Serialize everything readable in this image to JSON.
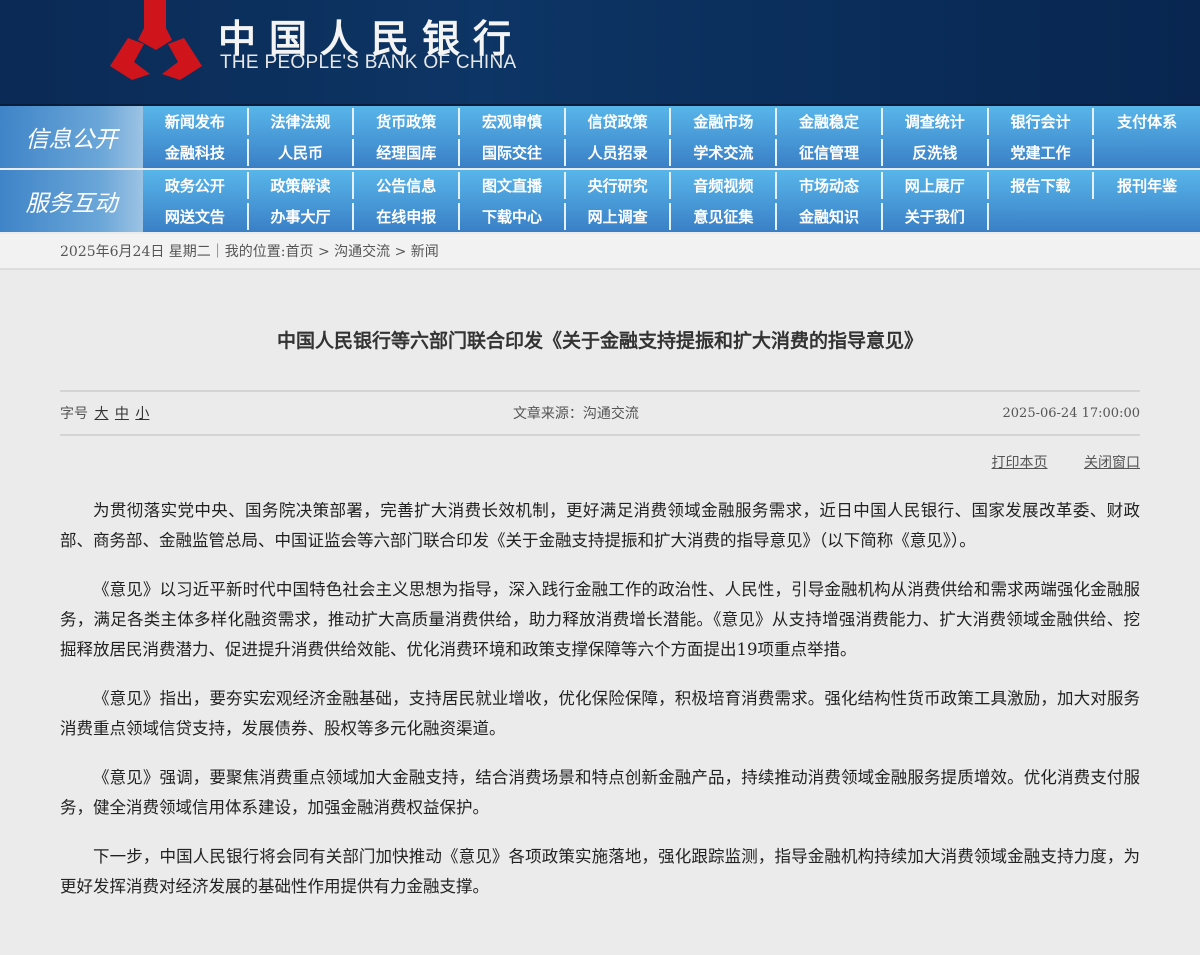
{
  "header": {
    "logo_cn": "中国人民银行",
    "logo_en": "THE PEOPLE'S BANK OF CHINA"
  },
  "nav": [
    {
      "label": "信息公开",
      "items": [
        "新闻发布",
        "法律法规",
        "货币政策",
        "宏观审慎",
        "信贷政策",
        "金融市场",
        "金融稳定",
        "调查统计",
        "银行会计",
        "支付体系",
        "金融科技",
        "人民币",
        "经理国库",
        "国际交往",
        "人员招录",
        "学术交流",
        "征信管理",
        "反洗钱",
        "党建工作",
        ""
      ]
    },
    {
      "label": "服务互动",
      "items": [
        "政务公开",
        "政策解读",
        "公告信息",
        "图文直播",
        "央行研究",
        "音频视频",
        "市场动态",
        "网上展厅",
        "报告下载",
        "报刊年鉴",
        "网送文告",
        "办事大厅",
        "在线申报",
        "下载中心",
        "网上调查",
        "意见征集",
        "金融知识",
        "关于我们",
        "",
        ""
      ]
    }
  ],
  "breadcrumb": "2025年6月24日 星期二｜我的位置:首页 > 沟通交流 > 新闻",
  "article": {
    "title": "中国人民银行等六部门联合印发《关于金融支持提振和扩大消费的指导意见》",
    "font_size_label": "字号",
    "font_sizes": [
      "大",
      "中",
      "小"
    ],
    "source": "文章来源：沟通交流",
    "date": "2025-06-24 17:00:00",
    "print": "打印本页",
    "close": "关闭窗口",
    "paragraphs": [
      "为贯彻落实党中央、国务院决策部署，完善扩大消费长效机制，更好满足消费领域金融服务需求，近日中国人民银行、国家发展改革委、财政部、商务部、金融监管总局、中国证监会等六部门联合印发《关于金融支持提振和扩大消费的指导意见》（以下简称《意见》）。",
      "《意见》以习近平新时代中国特色社会主义思想为指导，深入践行金融工作的政治性、人民性，引导金融机构从消费供给和需求两端强化金融服务，满足各类主体多样化融资需求，推动扩大高质量消费供给，助力释放消费增长潜能。《意见》从支持增强消费能力、扩大消费领域金融供给、挖掘释放居民消费潜力、促进提升消费供给效能、优化消费环境和政策支撑保障等六个方面提出19项重点举措。",
      "《意见》指出，要夯实宏观经济金融基础，支持居民就业增收，优化保险保障，积极培育消费需求。强化结构性货币政策工具激励，加大对服务消费重点领域信贷支持，发展债券、股权等多元化融资渠道。",
      "《意见》强调，要聚焦消费重点领域加大金融支持，结合消费场景和特点创新金融产品，持续推动消费领域金融服务提质增效。优化消费支付服务，健全消费领域信用体系建设，加强金融消费权益保护。",
      "下一步，中国人民银行将会同有关部门加快推动《意见》各项政策实施落地，强化跟踪监测，指导金融机构持续加大消费领域金融支持力度，为更好发挥消费对经济发展的基础性作用提供有力金融支撑。"
    ]
  }
}
